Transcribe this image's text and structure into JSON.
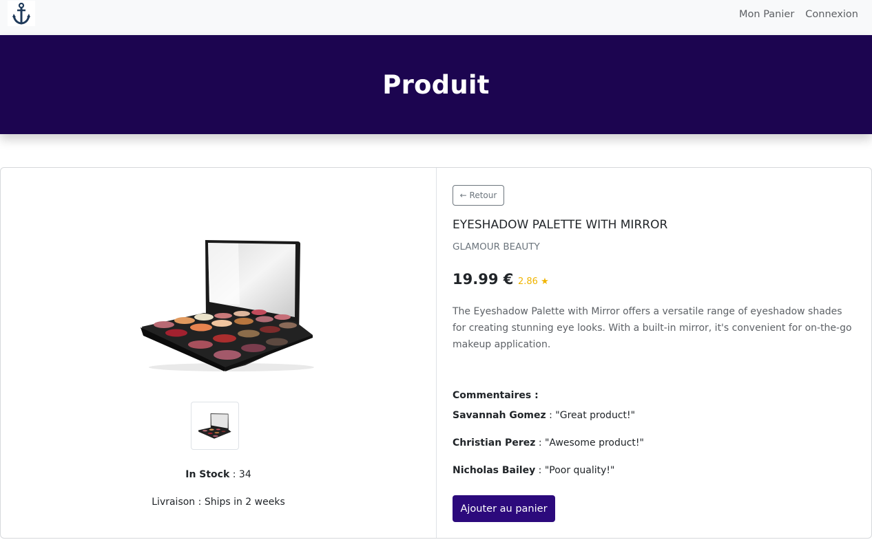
{
  "navbar": {
    "logo_icon": "anchor-icon",
    "links": [
      {
        "label": "Mon Panier"
      },
      {
        "label": "Connexion"
      }
    ]
  },
  "hero": {
    "title": "Produit"
  },
  "product": {
    "image_alt": "Eyeshadow palette with mirror",
    "stock_label": "In Stock",
    "stock_separator": " : ",
    "stock_value": "34",
    "delivery_label": "Livraison",
    "delivery_separator": " : ",
    "delivery_value": "Ships in 2 weeks",
    "back_label": "← Retour",
    "title": "EYESHADOW PALETTE WITH MIRROR",
    "brand": "GLAMOUR BEAUTY",
    "price": "19.99 €",
    "rating": "2.86 ★",
    "description": "The Eyeshadow Palette with Mirror offers a versatile range of eyeshadow shades for creating stunning eye looks. With a built-in mirror, it's convenient for on-the-go makeup application.",
    "comments_label": "Commentaires :",
    "comments": [
      {
        "author": "Savannah Gomez",
        "text": " : \"Great product!\""
      },
      {
        "author": "Christian Perez",
        "text": " : \"Awesome product!\""
      },
      {
        "author": "Nicholas Bailey",
        "text": " : \"Poor quality!\""
      }
    ],
    "add_to_cart_label": "Ajouter au panier"
  },
  "colors": {
    "hero_bg": "#1c0550",
    "primary_button": "#2c0a7c",
    "rating": "#f0b400"
  }
}
